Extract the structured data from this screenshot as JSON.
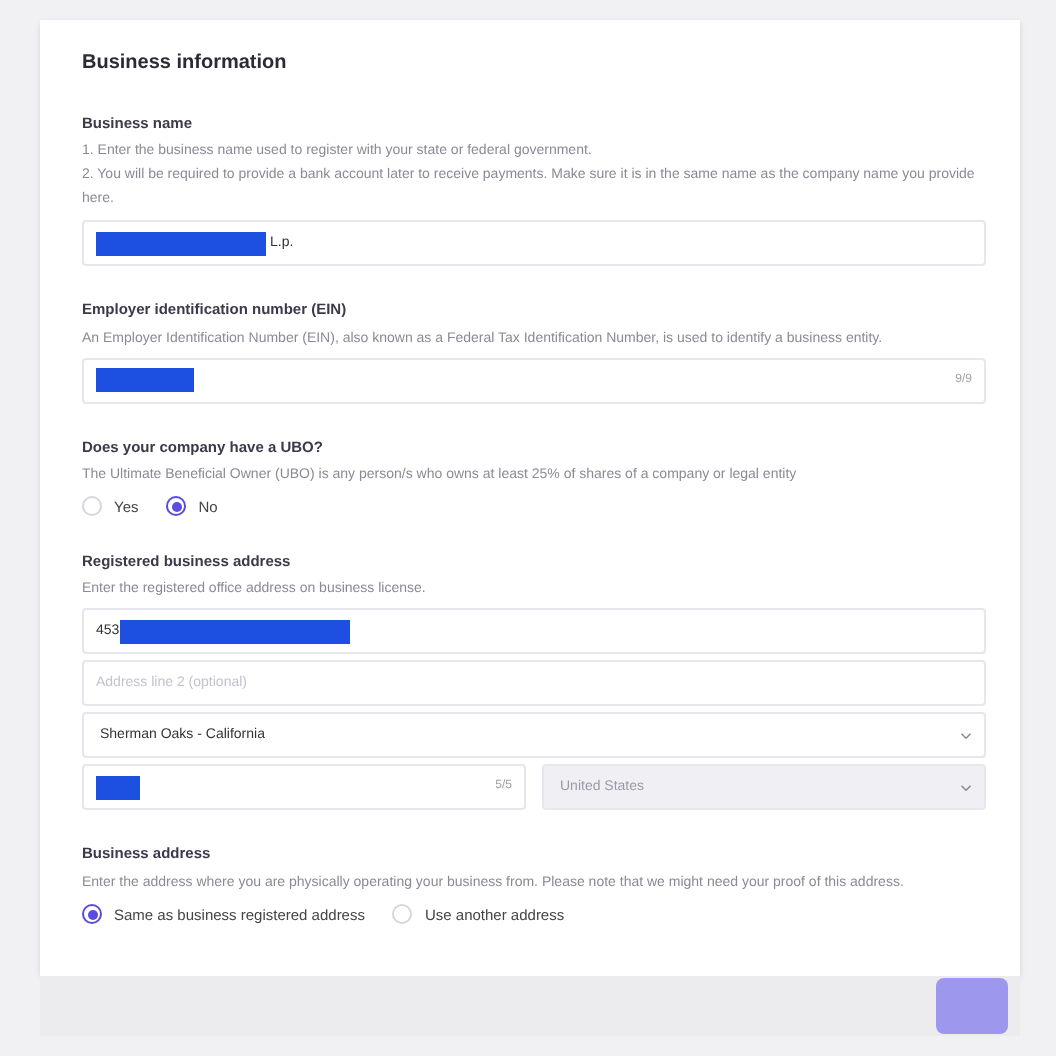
{
  "title": "Business information",
  "business_name": {
    "label": "Business name",
    "help": [
      "1. Enter the business name used to register with your state or federal government.",
      "2. You will be required to provide a bank account later to receive payments. Make sure it is in the same name as the company name you provide here."
    ],
    "value": "L.p.",
    "redacted": true
  },
  "ein": {
    "label": "Employer identification number (EIN)",
    "help": "An Employer Identification Number (EIN), also known as a Federal Tax Identification Number, is used to identify a business entity.",
    "redacted": true,
    "counter": "9/9"
  },
  "ubo": {
    "label": "Does your company have a UBO?",
    "help": "The Ultimate Beneficial Owner (UBO) is any person/s who owns at least 25% of shares of a company or legal entity",
    "options": [
      {
        "label": "Yes",
        "selected": false
      },
      {
        "label": "No",
        "selected": true
      }
    ]
  },
  "registered_address": {
    "label": "Registered business address",
    "help": "Enter the registered office address on business license.",
    "address_line_1": {
      "value": "453",
      "redacted": true
    },
    "address_line_2": {
      "placeholder": "Address line 2 (optional)"
    },
    "city": {
      "value": "Sherman Oaks - California"
    },
    "zip": {
      "redacted": true,
      "counter": "5/5"
    },
    "country": {
      "value": "United States",
      "disabled": true
    }
  },
  "business_address": {
    "label": "Business address",
    "help": "Enter the address where you are physically operating your business from. Please note that we might need your proof of this address.",
    "options": [
      {
        "label": "Same as business registered address",
        "selected": true
      },
      {
        "label": "Use another address",
        "selected": false
      }
    ]
  }
}
